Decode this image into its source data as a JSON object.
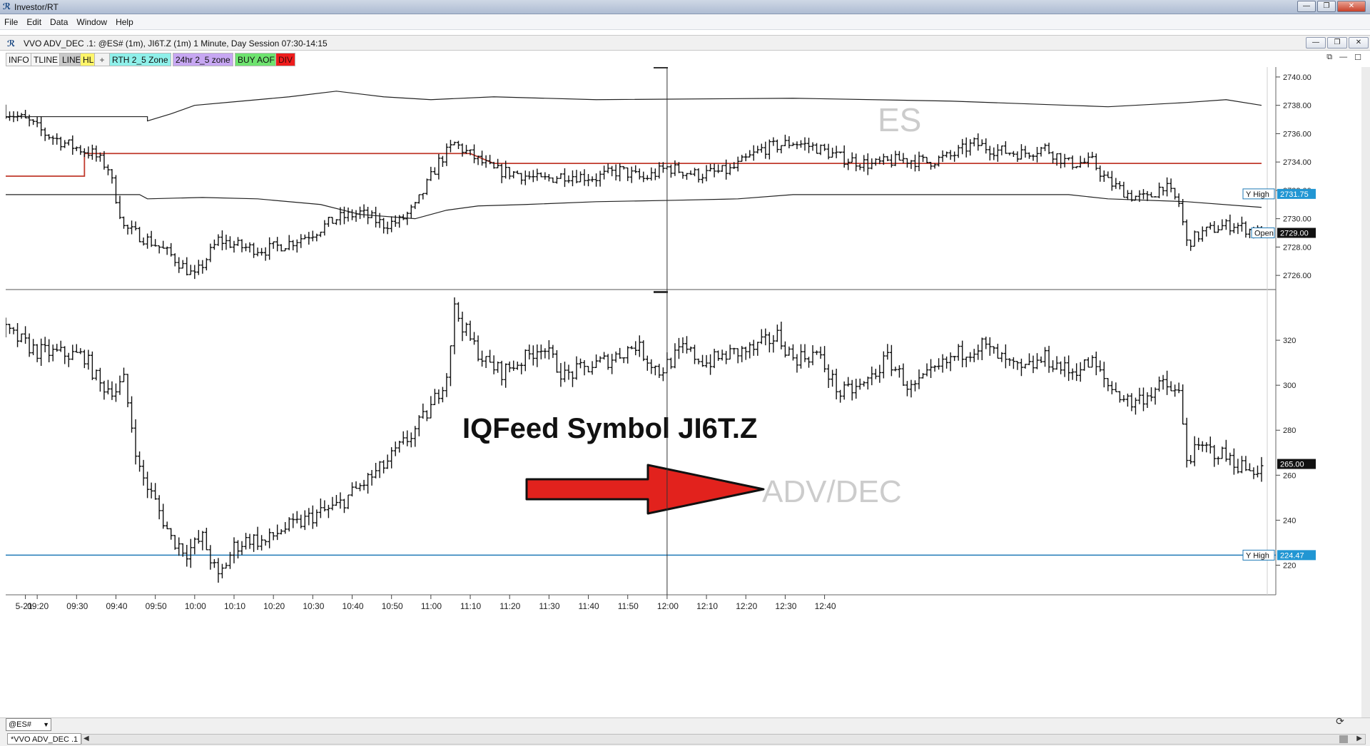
{
  "window": {
    "title": "Investor/RT",
    "controls": [
      "—",
      "❐",
      "✕"
    ]
  },
  "menu": [
    "File",
    "Edit",
    "Data",
    "Window",
    "Help"
  ],
  "chart_window": {
    "title": "VVO ADV_DEC .1: @ES# (1m), JI6T.Z (1m) 1 Minute, Day Session 07:30-14:15",
    "controls": [
      "—",
      "❐",
      "✕"
    ]
  },
  "toolbar": {
    "info": "INFO",
    "tline": "TLINE",
    "line": "LINE",
    "hl": "HL",
    "cross": "+",
    "rth": "RTH 2_5 Zone",
    "h24": "24hr 2_5 zone",
    "buy": "BUY AOF",
    "div": "DIV"
  },
  "footer": {
    "symbol": "@ES#",
    "tab": "*VVO ADV_DEC .1"
  },
  "colors": {
    "bars": "#111111",
    "red_line": "#c0392b",
    "y_high_line": "#1f7ab6",
    "arrow": "#e2221d",
    "marker_fill": "#2196d3"
  },
  "chart_data": [
    {
      "type": "ohlc",
      "symbol": "ES",
      "watermark": "ES",
      "ylim": [
        2725.0,
        2740.5
      ],
      "yticks": [
        "2740.00",
        "2738.00",
        "2736.00",
        "2734.00",
        "2732.00",
        "2730.00",
        "2728.00",
        "2726.00"
      ],
      "markers": [
        {
          "label": "Y High",
          "value": "2731.75"
        },
        {
          "label": "Open",
          "value": "2729.00"
        }
      ],
      "price_path": [
        [
          0,
          2737.6
        ],
        [
          6,
          2736.8
        ],
        [
          10,
          2736.0
        ],
        [
          16,
          2735.2
        ],
        [
          22,
          2734.6
        ],
        [
          26,
          2733.6
        ],
        [
          30,
          2729.4
        ],
        [
          34,
          2728.8
        ],
        [
          38,
          2728.2
        ],
        [
          42,
          2727.4
        ],
        [
          48,
          2725.9
        ],
        [
          54,
          2728.5
        ],
        [
          60,
          2728.0
        ],
        [
          66,
          2727.8
        ],
        [
          72,
          2728.3
        ],
        [
          78,
          2729.0
        ],
        [
          84,
          2730.0
        ],
        [
          90,
          2730.4
        ],
        [
          96,
          2729.6
        ],
        [
          100,
          2729.8
        ],
        [
          104,
          2730.8
        ],
        [
          110,
          2734.0
        ],
        [
          114,
          2735.3
        ],
        [
          118,
          2734.5
        ],
        [
          124,
          2733.4
        ],
        [
          130,
          2733.2
        ],
        [
          136,
          2732.7
        ],
        [
          142,
          2733.1
        ],
        [
          150,
          2732.9
        ],
        [
          156,
          2733.4
        ],
        [
          162,
          2732.8
        ],
        [
          168,
          2733.6
        ],
        [
          176,
          2733.1
        ],
        [
          184,
          2733.4
        ],
        [
          192,
          2734.9
        ],
        [
          200,
          2735.4
        ],
        [
          206,
          2735.0
        ],
        [
          212,
          2734.3
        ],
        [
          220,
          2733.8
        ],
        [
          228,
          2734.2
        ],
        [
          234,
          2734.0
        ],
        [
          240,
          2734.4
        ],
        [
          246,
          2735.3
        ],
        [
          252,
          2734.8
        ],
        [
          258,
          2734.6
        ],
        [
          264,
          2735.0
        ],
        [
          270,
          2733.9
        ],
        [
          276,
          2734.0
        ],
        [
          280,
          2732.6
        ],
        [
          286,
          2731.6
        ],
        [
          290,
          2731.4
        ],
        [
          294,
          2732.4
        ],
        [
          298,
          2731.1
        ],
        [
          300,
          2728.3
        ],
        [
          304,
          2729.0
        ],
        [
          308,
          2729.4
        ],
        [
          312,
          2729.6
        ],
        [
          316,
          2729.2
        ],
        [
          319,
          2729.0
        ]
      ],
      "red_line": [
        [
          0,
          2733.0
        ],
        [
          20,
          2733.0
        ],
        [
          20,
          2734.6
        ],
        [
          118,
          2734.6
        ],
        [
          124,
          2733.9
        ],
        [
          319,
          2733.9
        ]
      ],
      "upper_band": [
        [
          0,
          2737.2
        ],
        [
          36,
          2737.2
        ],
        [
          36,
          2736.9
        ],
        [
          42,
          2737.4
        ],
        [
          48,
          2738.0
        ],
        [
          60,
          2738.3
        ],
        [
          72,
          2738.6
        ],
        [
          84,
          2739.0
        ],
        [
          96,
          2738.6
        ],
        [
          108,
          2738.4
        ],
        [
          124,
          2738.6
        ],
        [
          150,
          2738.4
        ],
        [
          200,
          2738.5
        ],
        [
          240,
          2738.3
        ],
        [
          270,
          2738.0
        ],
        [
          280,
          2737.9
        ],
        [
          300,
          2738.2
        ],
        [
          310,
          2738.4
        ],
        [
          319,
          2738.0
        ]
      ],
      "lower_band": [
        [
          0,
          2731.7
        ],
        [
          34,
          2731.7
        ],
        [
          36,
          2731.4
        ],
        [
          50,
          2731.5
        ],
        [
          64,
          2731.4
        ],
        [
          80,
          2731.0
        ],
        [
          90,
          2730.3
        ],
        [
          104,
          2730.0
        ],
        [
          112,
          2730.6
        ],
        [
          120,
          2730.9
        ],
        [
          132,
          2731.0
        ],
        [
          150,
          2731.2
        ],
        [
          170,
          2731.3
        ],
        [
          186,
          2731.4
        ],
        [
          200,
          2731.7
        ],
        [
          270,
          2731.7
        ],
        [
          280,
          2731.4
        ],
        [
          300,
          2731.2
        ],
        [
          319,
          2730.8
        ]
      ]
    },
    {
      "type": "ohlc",
      "symbol": "JI6T.Z",
      "watermark": "ADV/DEC",
      "annotation": "IQFeed Symbol JI6T.Z",
      "ylim": [
        210,
        340
      ],
      "yticks": [
        "320",
        "300",
        "280",
        "260",
        "240",
        "220"
      ],
      "markers": [
        {
          "label": "",
          "value": "265.00"
        },
        {
          "label": "Y High",
          "value": "224.47"
        }
      ],
      "price_path": [
        [
          0,
          324
        ],
        [
          8,
          315
        ],
        [
          14,
          314
        ],
        [
          20,
          313
        ],
        [
          24,
          300
        ],
        [
          28,
          298
        ],
        [
          30,
          302
        ],
        [
          34,
          262
        ],
        [
          38,
          248
        ],
        [
          42,
          232
        ],
        [
          46,
          226
        ],
        [
          50,
          232
        ],
        [
          54,
          214
        ],
        [
          58,
          228
        ],
        [
          62,
          232
        ],
        [
          66,
          230
        ],
        [
          70,
          236
        ],
        [
          74,
          238
        ],
        [
          78,
          242
        ],
        [
          84,
          246
        ],
        [
          88,
          252
        ],
        [
          92,
          258
        ],
        [
          96,
          264
        ],
        [
          100,
          272
        ],
        [
          104,
          280
        ],
        [
          108,
          290
        ],
        [
          112,
          305
        ],
        [
          114,
          334
        ],
        [
          118,
          320
        ],
        [
          122,
          310
        ],
        [
          126,
          306
        ],
        [
          132,
          312
        ],
        [
          136,
          318
        ],
        [
          142,
          304
        ],
        [
          148,
          308
        ],
        [
          154,
          312
        ],
        [
          160,
          318
        ],
        [
          166,
          306
        ],
        [
          172,
          316
        ],
        [
          178,
          310
        ],
        [
          184,
          314
        ],
        [
          190,
          316
        ],
        [
          196,
          322
        ],
        [
          200,
          312
        ],
        [
          206,
          314
        ],
        [
          212,
          296
        ],
        [
          218,
          300
        ],
        [
          224,
          312
        ],
        [
          230,
          298
        ],
        [
          236,
          306
        ],
        [
          242,
          314
        ],
        [
          248,
          318
        ],
        [
          254,
          310
        ],
        [
          258,
          306
        ],
        [
          264,
          312
        ],
        [
          270,
          306
        ],
        [
          276,
          310
        ],
        [
          280,
          300
        ],
        [
          286,
          292
        ],
        [
          290,
          296
        ],
        [
          294,
          300
        ],
        [
          298,
          296
        ],
        [
          300,
          268
        ],
        [
          304,
          272
        ],
        [
          308,
          270
        ],
        [
          312,
          266
        ],
        [
          316,
          262
        ],
        [
          319,
          264
        ]
      ],
      "y_high_line": 224.47
    }
  ],
  "time_axis": {
    "labels": [
      "5-21",
      "09:20",
      "09:30",
      "09:40",
      "09:50",
      "10:00",
      "10:10",
      "10:20",
      "10:30",
      "10:40",
      "10:50",
      "11:00",
      "11:10",
      "11:20",
      "11:30",
      "11:40",
      "11:50",
      "12:00",
      "12:10",
      "12:20",
      "12:30",
      "12:40"
    ],
    "crosshair_time": "12:00"
  }
}
